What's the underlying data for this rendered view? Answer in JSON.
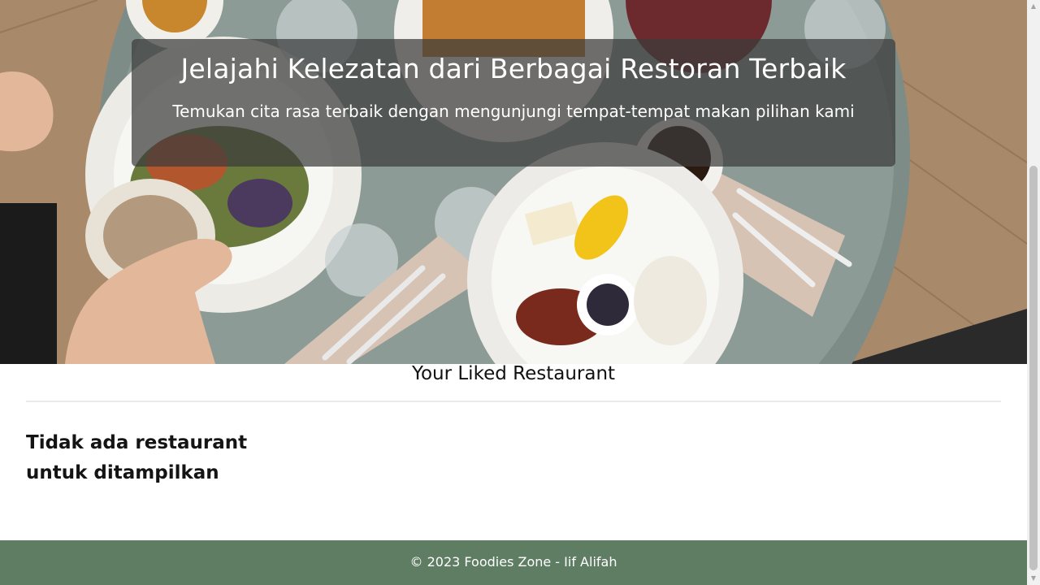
{
  "hero": {
    "title": "Jelajahi Kelezatan dari Berbagai Restoran Terbaik",
    "subtitle": "Temukan cita rasa terbaik dengan mengunjungi tempat-tempat makan pilihan kami",
    "image_icon": "restaurant-table-photo"
  },
  "content": {
    "heading": "Your Liked Restaurant",
    "empty_message": "Tidak ada restaurant untuk ditampilkan"
  },
  "footer": {
    "text": "© 2023 Foodies Zone - Iif Alifah"
  },
  "scrollbar": {
    "up_icon": "▲",
    "down_icon": "▼"
  },
  "colors": {
    "footer_bg": "#5e7d63",
    "overlay_bg": "rgba(60,60,60,0.72)"
  }
}
